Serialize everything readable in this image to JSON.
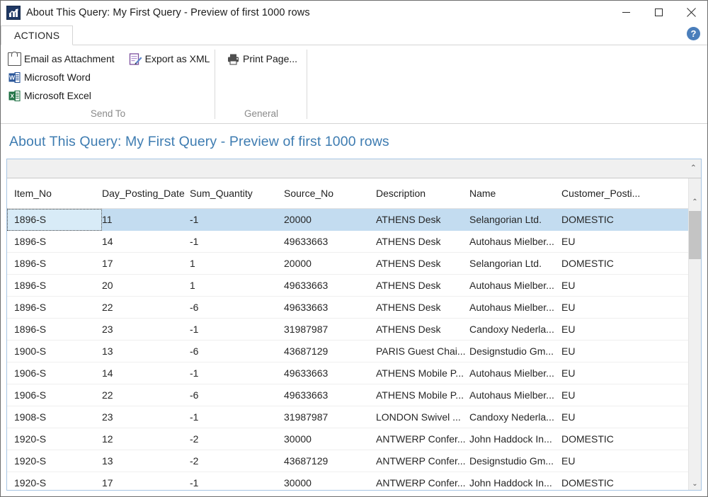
{
  "window": {
    "title": "About This Query: My First Query - Preview of first 1000 rows",
    "app_icon": "chart-app-icon",
    "minimize_label": "",
    "maximize_label": "",
    "close_label": "✕"
  },
  "ribbon": {
    "tab": "ACTIONS",
    "help_label": "?",
    "groups": [
      {
        "name": "Send To",
        "label": "Send To",
        "items": [
          {
            "label": "Email as Attachment",
            "icon": "email-attachment-icon"
          },
          {
            "label": "Export as XML",
            "icon": "export-xml-icon"
          },
          {
            "label": "Microsoft Word",
            "icon": "microsoft-word-icon"
          },
          {
            "label": "Microsoft Excel",
            "icon": "microsoft-excel-icon"
          }
        ]
      },
      {
        "name": "General",
        "label": "General",
        "items": [
          {
            "label": "Print Page...",
            "icon": "printer-icon"
          }
        ]
      }
    ]
  },
  "page": {
    "heading": "About This Query: My First Query - Preview of first 1000 rows"
  },
  "grid": {
    "collapse_chevron": "⌃",
    "scroll_up": "⌃",
    "scroll_down": "⌄",
    "columns": [
      "Item_No",
      "Day_Posting_Date",
      "Sum_Quantity",
      "Source_No",
      "Description",
      "Name",
      "Customer_Posti..."
    ],
    "rows": [
      {
        "selected": true,
        "cells": [
          "1896-S",
          "11",
          "-1",
          "20000",
          "ATHENS Desk",
          "Selangorian Ltd.",
          "DOMESTIC"
        ]
      },
      {
        "selected": false,
        "cells": [
          "1896-S",
          "14",
          "-1",
          "49633663",
          "ATHENS Desk",
          "Autohaus Mielber...",
          "EU"
        ]
      },
      {
        "selected": false,
        "cells": [
          "1896-S",
          "17",
          "1",
          "20000",
          "ATHENS Desk",
          "Selangorian Ltd.",
          "DOMESTIC"
        ]
      },
      {
        "selected": false,
        "cells": [
          "1896-S",
          "20",
          "1",
          "49633663",
          "ATHENS Desk",
          "Autohaus Mielber...",
          "EU"
        ]
      },
      {
        "selected": false,
        "cells": [
          "1896-S",
          "22",
          "-6",
          "49633663",
          "ATHENS Desk",
          "Autohaus Mielber...",
          "EU"
        ]
      },
      {
        "selected": false,
        "cells": [
          "1896-S",
          "23",
          "-1",
          "31987987",
          "ATHENS Desk",
          "Candoxy Nederla...",
          "EU"
        ]
      },
      {
        "selected": false,
        "cells": [
          "1900-S",
          "13",
          "-6",
          "43687129",
          "PARIS Guest Chai...",
          "Designstudio Gm...",
          "EU"
        ]
      },
      {
        "selected": false,
        "cells": [
          "1906-S",
          "14",
          "-1",
          "49633663",
          "ATHENS Mobile P...",
          "Autohaus Mielber...",
          "EU"
        ]
      },
      {
        "selected": false,
        "cells": [
          "1906-S",
          "22",
          "-6",
          "49633663",
          "ATHENS Mobile P...",
          "Autohaus Mielber...",
          "EU"
        ]
      },
      {
        "selected": false,
        "cells": [
          "1908-S",
          "23",
          "-1",
          "31987987",
          "LONDON Swivel ...",
          "Candoxy Nederla...",
          "EU"
        ]
      },
      {
        "selected": false,
        "cells": [
          "1920-S",
          "12",
          "-2",
          "30000",
          "ANTWERP Confer...",
          "John Haddock In...",
          "DOMESTIC"
        ]
      },
      {
        "selected": false,
        "cells": [
          "1920-S",
          "13",
          "-2",
          "43687129",
          "ANTWERP Confer...",
          "Designstudio Gm...",
          "EU"
        ]
      },
      {
        "selected": false,
        "cells": [
          "1920-S",
          "17",
          "-1",
          "30000",
          "ANTWERP Confer...",
          "John Haddock In...",
          "DOMESTIC"
        ]
      }
    ]
  },
  "colors": {
    "accent_heading": "#3e7cb1",
    "selection": "#c3dcf0",
    "grid_border": "#a6c5e3",
    "help_blue": "#4a7ebb",
    "word_blue": "#2b579a",
    "excel_green": "#207245",
    "xml_purple": "#7b4f9d"
  }
}
